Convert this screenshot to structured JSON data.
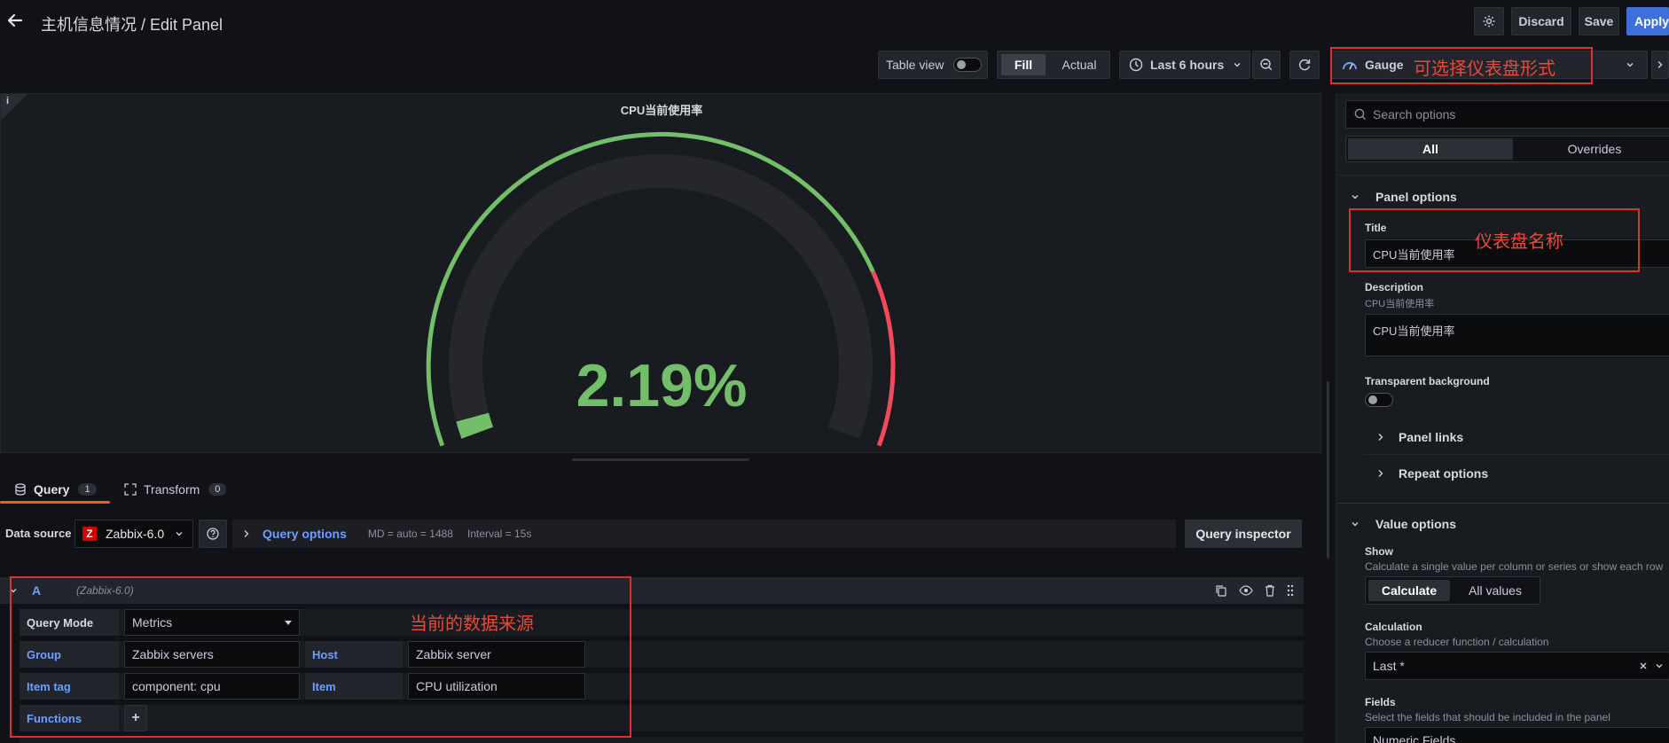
{
  "header": {
    "title": "主机信息情况 / Edit Panel",
    "discard_label": "Discard",
    "save_label": "Save",
    "apply_label": "Apply"
  },
  "toolbar": {
    "table_view_label": "Table view",
    "fill_label": "Fill",
    "actual_label": "Actual",
    "time_range_label": "Last 6 hours",
    "viz_label": "Gauge"
  },
  "panel": {
    "title": "CPU当前使用率",
    "value_text": "2.19%",
    "gauge_fraction": 0.0219,
    "info_glyph": "i"
  },
  "query_tabs": [
    {
      "label": "Query",
      "count": "1"
    },
    {
      "label": "Transform",
      "count": "0"
    }
  ],
  "datasource": {
    "label": "Data source",
    "name": "Zabbix-6.0",
    "query_options_label": "Query options",
    "md_text": "MD = auto = 1488",
    "interval_text": "Interval = 15s",
    "inspector_label": "Query inspector"
  },
  "query": {
    "ref_id": "A",
    "ds_hint": "(Zabbix-6.0)",
    "mode_label": "Query Mode",
    "mode_value": "Metrics",
    "group_label": "Group",
    "group_value": "Zabbix servers",
    "host_label": "Host",
    "host_value": "Zabbix server",
    "item_tag_label": "Item tag",
    "item_tag_value": "component: cpu",
    "item_label": "Item",
    "item_value": "CPU utilization",
    "functions_label": "Functions",
    "add_glyph": "+"
  },
  "options": {
    "search_placeholder": "Search options",
    "tab_all": "All",
    "tab_overrides": "Overrides",
    "panel_options_label": "Panel options",
    "title_label": "Title",
    "title_value": "CPU当前使用率",
    "description_label": "Description",
    "description_hint": "CPU当前使用率",
    "description_value": "CPU当前使用率",
    "transparent_label": "Transparent background",
    "panel_links_label": "Panel links",
    "repeat_options_label": "Repeat options",
    "value_options_label": "Value options",
    "show_label": "Show",
    "show_desc": "Calculate a single value per column or series or show each row",
    "calculate_label": "Calculate",
    "all_values_label": "All values",
    "calculation_label": "Calculation",
    "calculation_desc": "Choose a reducer function / calculation",
    "calculation_value": "Last *",
    "fields_label": "Fields",
    "fields_desc": "Select the fields that should be included in the panel",
    "fields_value": "Numeric Fields"
  },
  "annotations": {
    "gauge_note": "可选择仪表盘形式",
    "title_note": "仪表盘名称",
    "source_note": "当前的数据来源"
  },
  "icons": {
    "back": "arrow-left-icon",
    "settings": "gear-icon",
    "clock": "clock-icon",
    "zoom_out": "zoom-out-icon",
    "refresh": "refresh-icon",
    "search": "search-icon",
    "database": "database-icon",
    "transform": "transform-icon",
    "help": "question-circle-icon",
    "copy": "copy-icon",
    "eye": "eye-icon",
    "trash": "trash-icon",
    "drag": "drag-handle-icon",
    "zabbix_logo": "zabbix-logo-icon"
  },
  "colors": {
    "gauge_green": "#73bf69",
    "gauge_red": "#f2495c",
    "accent_blue": "#3d71d9",
    "tab_underline": "#f05a28",
    "annotation_red": "#e02f2f"
  }
}
